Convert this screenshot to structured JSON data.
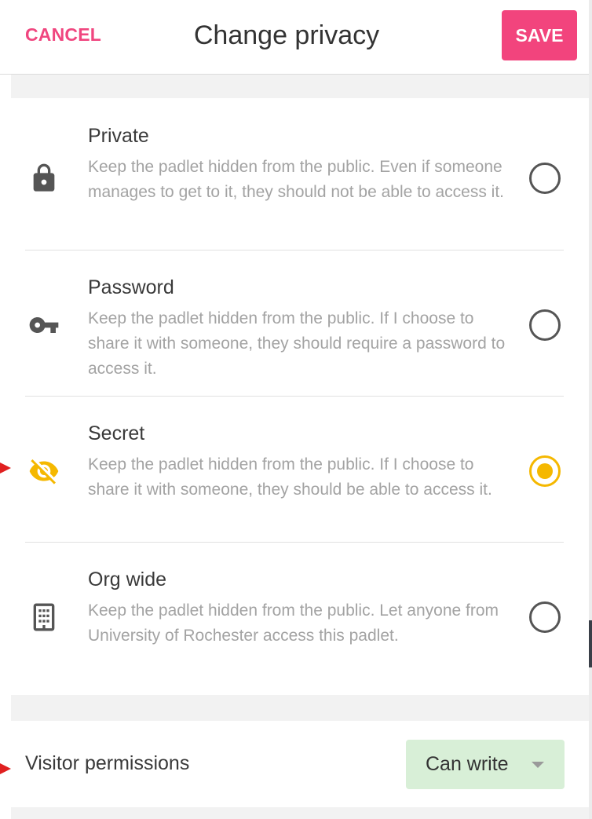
{
  "header": {
    "cancel_label": "CANCEL",
    "title": "Change privacy",
    "save_label": "SAVE"
  },
  "options": [
    {
      "title": "Private",
      "description": "Keep the padlet hidden from the public. Even if someone manages to get to it, they should not be able to access it.",
      "icon": "lock-icon",
      "selected": false
    },
    {
      "title": "Password",
      "description": "Keep the padlet hidden from the public. If I choose to share it with someone, they should require a password to access it.",
      "icon": "key-icon",
      "selected": false
    },
    {
      "title": "Secret",
      "description": "Keep the padlet hidden from the public. If I choose to share it with someone, they should be able to access it.",
      "icon": "eye-off-icon",
      "selected": true
    },
    {
      "title": "Org wide",
      "description": "Keep the padlet hidden from the public. Let anyone from University of Rochester access this padlet.",
      "icon": "building-icon",
      "selected": false
    }
  ],
  "visitor": {
    "label": "Visitor permissions",
    "value": "Can write"
  },
  "colors": {
    "accent_pink": "#f2447d",
    "selected_yellow": "#f5b800",
    "permission_green": "#d8efd7",
    "annotation_arrow_red": "#e02020"
  }
}
